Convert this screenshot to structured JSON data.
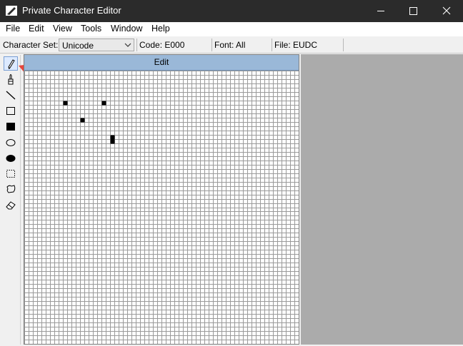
{
  "window": {
    "title": "Private Character Editor"
  },
  "menu": [
    "File",
    "Edit",
    "View",
    "Tools",
    "Window",
    "Help"
  ],
  "infobar": {
    "charset_label": "Character Set:",
    "charset_value": "Unicode",
    "code": "Code: E000",
    "font": "Font: All",
    "file": "File: EUDC"
  },
  "editor": {
    "caption": "Edit",
    "grid_size": 64,
    "filled_cells": [
      [
        9,
        7
      ],
      [
        18,
        7
      ],
      [
        13,
        11
      ],
      [
        20,
        15
      ],
      [
        20,
        16
      ]
    ]
  },
  "tools": [
    "pencil-tool",
    "brush-tool",
    "line-tool",
    "hollow-rectangle-tool",
    "filled-rectangle-tool",
    "hollow-ellipse-tool",
    "filled-ellipse-tool",
    "rectangular-selection-tool",
    "freeform-selection-tool",
    "eraser-tool"
  ],
  "colors": {
    "titlebar": "#2b2b2b",
    "caption": "#9ab8d8",
    "arrow": "#e8453c",
    "workspace": "#ababab"
  }
}
